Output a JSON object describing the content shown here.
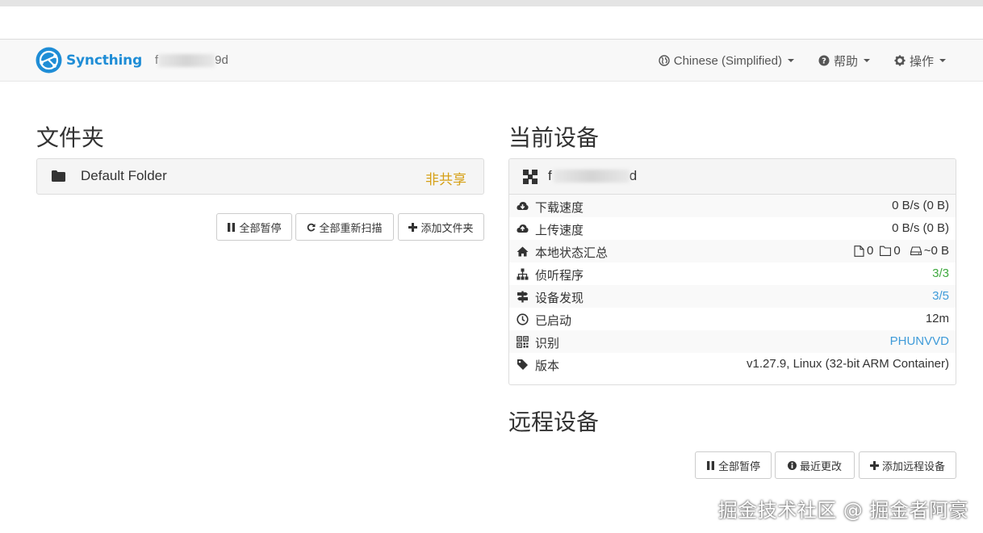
{
  "navbar": {
    "brand": "Syncthing",
    "device_name_start": "f",
    "device_name_end": "9d",
    "language": "Chinese (Simplified)",
    "help": "帮助",
    "actions": "操作"
  },
  "folders": {
    "title": "文件夹",
    "items": [
      {
        "name": "Default Folder",
        "status": "非共享"
      }
    ],
    "buttons": {
      "pause_all": "全部暂停",
      "rescan_all": "全部重新扫描",
      "add_folder": "添加文件夹"
    }
  },
  "this_device": {
    "title": "当前设备",
    "name_start": "f",
    "name_end": "d",
    "rows": [
      {
        "label": "下载速度",
        "value": "0 B/s (0 B)"
      },
      {
        "label": "上传速度",
        "value": "0 B/s (0 B)"
      },
      {
        "label": "本地状态汇总",
        "files": "0",
        "dirs": "0",
        "size": "~0 B"
      },
      {
        "label": "侦听程序",
        "value": "3/3"
      },
      {
        "label": "设备发现",
        "value": "3/5"
      },
      {
        "label": "已启动",
        "value": "12m"
      },
      {
        "label": "识别",
        "value": "PHUNVVD"
      },
      {
        "label": "版本",
        "value": "v1.27.9, Linux (32-bit ARM Container)"
      }
    ]
  },
  "remote_devices": {
    "title": "远程设备",
    "buttons": {
      "pause_all": "全部暂停",
      "recent_changes": "最近更改",
      "add_device": "添加远程设备"
    }
  },
  "watermark": "掘金技术社区 @ 掘金者阿豪",
  "colors": {
    "brand": "#1f8dd6",
    "unshared": "#d6a016",
    "ok_green": "#3fa93f",
    "link_blue": "#3f9bd9"
  },
  "icons": {
    "brand": "syncthing-logo",
    "language": "globe-icon",
    "help": "question-circle-icon",
    "actions": "gear-icon",
    "folder": "folder-icon",
    "pause": "pause-icon",
    "rescan": "refresh-icon",
    "add": "plus-icon",
    "device": "qrcode-device-icon",
    "download": "cloud-download-icon",
    "upload": "cloud-upload-icon",
    "local_state": "home-icon",
    "listeners": "sitemap-icon",
    "discovery": "signpost-icon",
    "uptime": "clock-icon",
    "identity": "qrcode-icon",
    "version": "tag-icon",
    "info": "info-circle-icon"
  }
}
